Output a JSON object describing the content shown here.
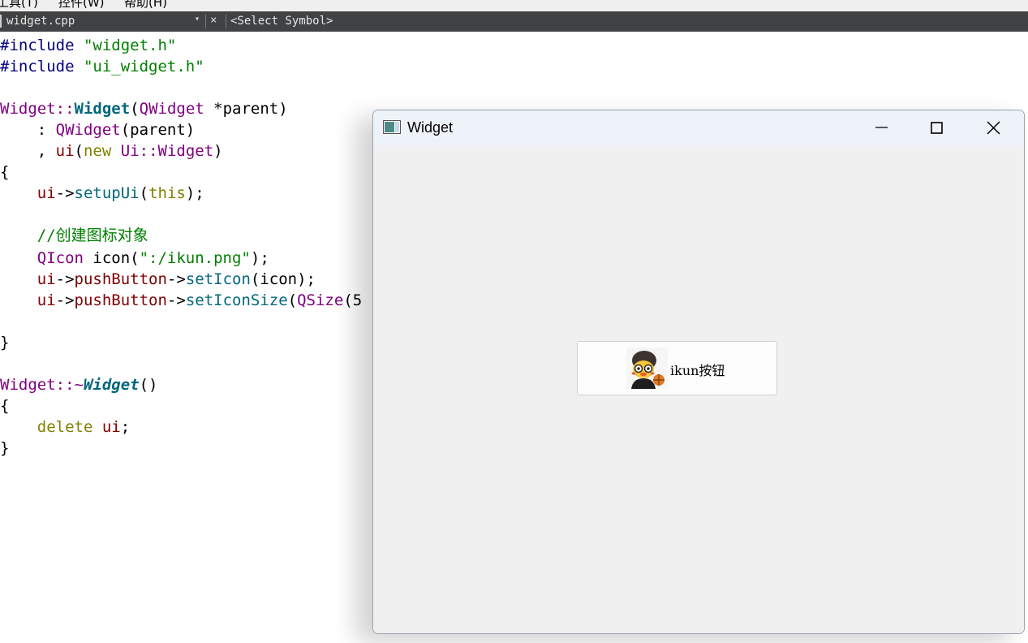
{
  "menubar": {
    "items": [
      "工具(T)",
      "控件(W)",
      "帮助(H)"
    ]
  },
  "doc_bar": {
    "file_name": "widget.cpp",
    "dropdown_glyph": "▾",
    "close_glyph": "×",
    "symbol_selector": "<Select Symbol>"
  },
  "editor": {
    "lines": {
      "l1_a": "#include ",
      "l1_b": "\"widget.h\"",
      "l2_a": "#include ",
      "l2_b": "\"ui_widget.h\"",
      "l4_a": "Widget",
      "l4_b": "::",
      "l4_c": "Widget",
      "l4_d": "(",
      "l4_e": "QWidget",
      "l4_f": " *parent)",
      "l5_a": "    : ",
      "l5_b": "QWidget",
      "l5_c": "(parent)",
      "l6_a": "    , ",
      "l6_b": "ui",
      "l6_c": "(",
      "l6_d": "new",
      "l6_e": " Ui",
      "l6_f": "::",
      "l6_g": "Widget",
      "l6_h": ")",
      "l7": "{",
      "l8_a": "    ui",
      "l8_b": "->",
      "l8_c": "setupUi",
      "l8_d": "(",
      "l8_e": "this",
      "l8_f": ");",
      "l10": "    //创建图标对象",
      "l11_a": "    QIcon",
      "l11_b": " icon(",
      "l11_c": "\":/ikun.png\"",
      "l11_d": ");",
      "l12_a": "    ui",
      "l12_b": "->",
      "l12_c": "pushButton",
      "l12_d": "->",
      "l12_e": "setIcon",
      "l12_f": "(icon);",
      "l13_a": "    ui",
      "l13_b": "->",
      "l13_c": "pushButton",
      "l13_d": "->",
      "l13_e": "setIconSize",
      "l13_f": "(",
      "l13_g": "QSize",
      "l13_h": "(5",
      "l15": "}",
      "l17_a": "Widget",
      "l17_b": "::~",
      "l17_c": "Widget",
      "l17_d": "()",
      "l18": "{",
      "l19_a": "    delete",
      "l19_b": " ui",
      "l19_c": ";",
      "l20": "}"
    }
  },
  "qt_window": {
    "title": "Widget",
    "minimize_icon": "minimize-icon",
    "maximize_icon": "maximize-icon",
    "close_icon": "close-icon",
    "button_label": "ikun按钮",
    "button_icon": "ikun-icon"
  }
}
